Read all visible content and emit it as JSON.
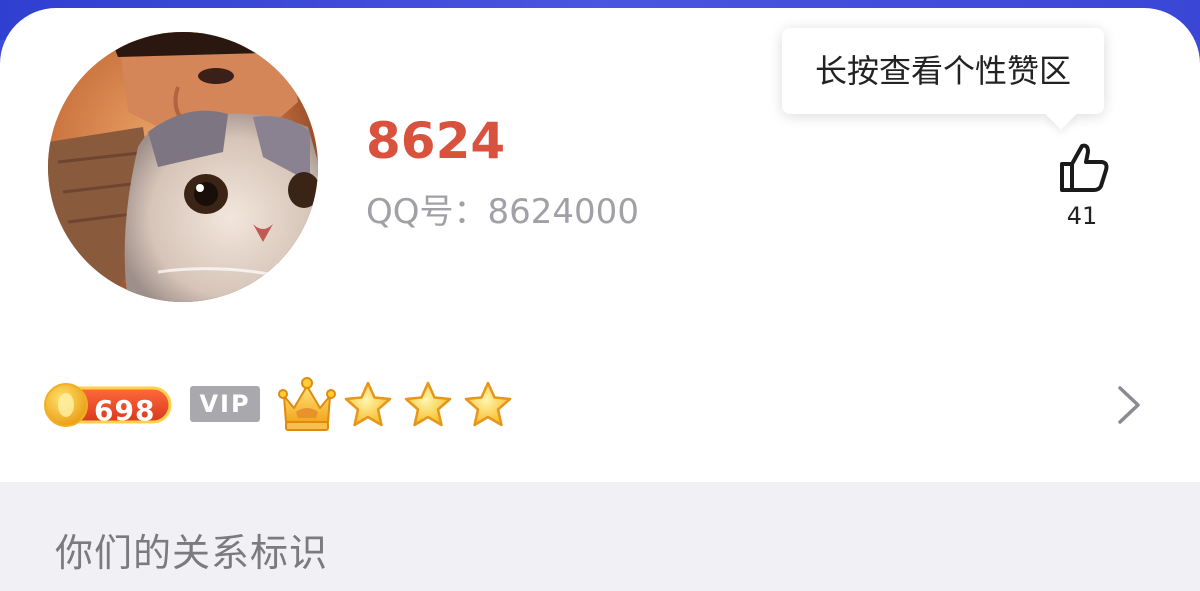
{
  "profile": {
    "nickname": "8624",
    "qq_line": "QQ号：8624000"
  },
  "tooltip": {
    "text": "长按查看个性赞区"
  },
  "like": {
    "count": "41",
    "icon": "thumbs-up-icon"
  },
  "badges": {
    "coin_value": "698",
    "vip_label": "VIP",
    "crown_icon": "crown-icon",
    "stars": 3
  },
  "section": {
    "title": "你们的关系标识"
  },
  "colors": {
    "nickname": "#d9523e",
    "accent_top": "#3b4cd8",
    "muted_text": "#a0a0a6"
  }
}
